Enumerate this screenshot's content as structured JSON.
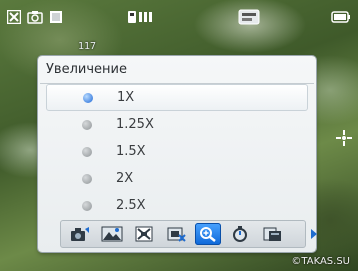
{
  "status_bar": {
    "icons": [
      "close-icon",
      "camera-mode-icon",
      "white-balance-icon",
      "resolution-icon",
      "storage-card-icon",
      "battery-icon"
    ],
    "shot_count": "117"
  },
  "zoom_menu": {
    "title": "Увеличение",
    "options": [
      {
        "label": "1X",
        "selected": true
      },
      {
        "label": "1.25X",
        "selected": false
      },
      {
        "label": "1.5X",
        "selected": false
      },
      {
        "label": "2X",
        "selected": false
      },
      {
        "label": "2.5X",
        "selected": false
      }
    ]
  },
  "toolbar": {
    "items": [
      {
        "icon": "capture-mode-icon",
        "selected": false
      },
      {
        "icon": "scene-landscape-icon",
        "selected": false
      },
      {
        "icon": "effect-icon",
        "selected": false
      },
      {
        "icon": "timer-icon",
        "selected": false
      },
      {
        "icon": "zoom-icon",
        "selected": true
      },
      {
        "icon": "self-timer-icon",
        "selected": false
      },
      {
        "icon": "storage-icon",
        "selected": false
      }
    ],
    "more_icon": "chevron-right-icon"
  },
  "watermark": "©TAKAS.SU",
  "colors": {
    "accent": "#1c67d6",
    "menu_bg": "#f0f3f5"
  }
}
